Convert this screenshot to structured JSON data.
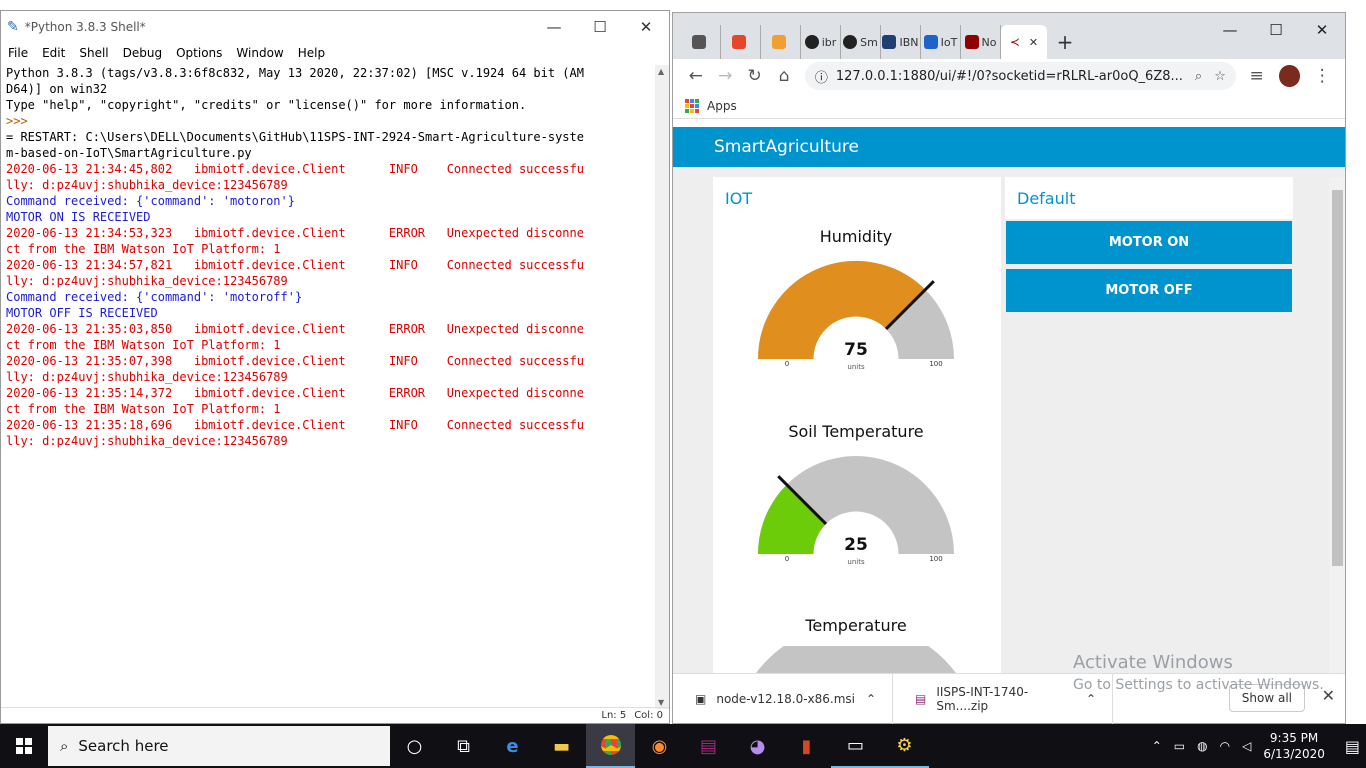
{
  "idle": {
    "title": "*Python 3.8.3 Shell*",
    "menu": [
      "File",
      "Edit",
      "Shell",
      "Debug",
      "Options",
      "Window",
      "Help"
    ],
    "lines": [
      {
        "t": "Python 3.8.3 (tags/v3.8.3:6f8c832, May 13 2020, 22:37:02) [MSC v.1924 64 bit (AM",
        "c": "out"
      },
      {
        "t": "D64)] on win32",
        "c": "out"
      },
      {
        "t": "Type \"help\", \"copyright\", \"credits\" or \"license()\" for more information.",
        "c": "out"
      },
      {
        "t": ">>> ",
        "c": "prompt"
      },
      {
        "t": "= RESTART: C:\\Users\\DELL\\Documents\\GitHub\\11SPS-INT-2924-Smart-Agriculture-syste",
        "c": "out"
      },
      {
        "t": "m-based-on-IoT\\SmartAgriculture.py",
        "c": "out"
      },
      {
        "t": "2020-06-13 21:34:45,802   ibmiotf.device.Client      INFO    Connected successfu",
        "c": "err"
      },
      {
        "t": "lly: d:pz4uvj:shubhika_device:123456789",
        "c": "err"
      },
      {
        "t": "Command received: {'command': 'motoron'}",
        "c": "blue"
      },
      {
        "t": "MOTOR ON IS RECEIVED",
        "c": "blue"
      },
      {
        "t": "2020-06-13 21:34:53,323   ibmiotf.device.Client      ERROR   Unexpected disconne",
        "c": "err"
      },
      {
        "t": "ct from the IBM Watson IoT Platform: 1",
        "c": "err"
      },
      {
        "t": "2020-06-13 21:34:57,821   ibmiotf.device.Client      INFO    Connected successfu",
        "c": "err"
      },
      {
        "t": "lly: d:pz4uvj:shubhika_device:123456789",
        "c": "err"
      },
      {
        "t": "Command received: {'command': 'motoroff'}",
        "c": "blue"
      },
      {
        "t": "MOTOR OFF IS RECEIVED",
        "c": "blue"
      },
      {
        "t": "2020-06-13 21:35:03,850   ibmiotf.device.Client      ERROR   Unexpected disconne",
        "c": "err"
      },
      {
        "t": "ct from the IBM Watson IoT Platform: 1",
        "c": "err"
      },
      {
        "t": "2020-06-13 21:35:07,398   ibmiotf.device.Client      INFO    Connected successfu",
        "c": "err"
      },
      {
        "t": "lly: d:pz4uvj:shubhika_device:123456789",
        "c": "err"
      },
      {
        "t": "2020-06-13 21:35:14,372   ibmiotf.device.Client      ERROR   Unexpected disconne",
        "c": "err"
      },
      {
        "t": "ct from the IBM Watson IoT Platform: 1",
        "c": "err"
      },
      {
        "t": "2020-06-13 21:35:18,696   ibmiotf.device.Client      INFO    Connected successfu",
        "c": "err"
      },
      {
        "t": "lly: d:pz4uvj:shubhika_device:123456789",
        "c": "err"
      }
    ],
    "status": {
      "ln": "Ln: 5",
      "col": "Col: 0"
    }
  },
  "browser": {
    "tabs": [
      {
        "label": "",
        "color": "#555555"
      },
      {
        "label": "",
        "color": "#e4472a"
      },
      {
        "label": "",
        "color": "#f0a030"
      },
      {
        "label": "ibr",
        "color": "#222222"
      },
      {
        "label": "Sm",
        "color": "#222222"
      },
      {
        "label": "IBN",
        "color": "#1f3f73"
      },
      {
        "label": "IoT",
        "color": "#1e64c8"
      },
      {
        "label": "No",
        "color": "#8f0000"
      }
    ],
    "url": "127.0.0.1:1880/ui/#!/0?socketid=rRLRL-ar0oQ_6Z8...",
    "bookmarks_apps": "Apps"
  },
  "dashboard": {
    "title": "SmartAgriculture",
    "group_iot": "IOT",
    "group_default": "Default",
    "buttons": {
      "motor_on": "MOTOR ON",
      "motor_off": "MOTOR OFF"
    },
    "gauges": [
      {
        "title": "Humidity",
        "value": 75,
        "min": 0,
        "max": 100,
        "units": "units",
        "color": "#e08e1e"
      },
      {
        "title": "Soil Temperature",
        "value": 25,
        "min": 0,
        "max": 100,
        "units": "units",
        "color": "#6ccc0a"
      },
      {
        "title": "Temperature"
      }
    ]
  },
  "downloads": [
    {
      "name": "node-v12.18.0-x86.msi"
    },
    {
      "name": "IISPS-INT-1740-Sm....zip"
    }
  ],
  "downloads_show_all": "Show all",
  "activate": {
    "title": "Activate Windows",
    "sub": "Go to Settings to activate Windows."
  },
  "taskbar": {
    "search_placeholder": "Search here",
    "time": "9:35 PM",
    "date": "6/13/2020"
  }
}
